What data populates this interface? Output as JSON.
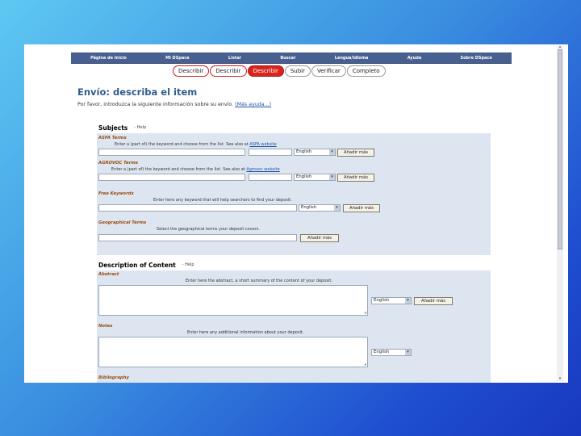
{
  "nav": {
    "items": [
      "Página de inicio",
      "Mi DSpace",
      "Listar",
      "Buscar",
      "Lengua/Idioma",
      "Ayuda",
      "Sobre DSpace"
    ]
  },
  "steps": [
    "Describir",
    "Describir",
    "Describir",
    "Subir",
    "Verificar",
    "Completo"
  ],
  "title": "Envío: describa el item",
  "intro": {
    "text": "Por favor, introduzca la siguiente información sobre su envío.",
    "link": "(Más ayuda...)"
  },
  "subjects": {
    "heading": "Subjects",
    "help": "- Help",
    "asfa": {
      "label": "ASFA Terms",
      "hint": "Enter a (part of) the keyword and choose from the list. See also at",
      "link": "ASFA website",
      "lang": "English",
      "add": "Añadir más"
    },
    "agrovoc": {
      "label": "AGROVOC Terms",
      "hint": "Enter a (part of) the keyword and choose from the list. See also at",
      "link": "Agrovoc website",
      "lang": "English",
      "add": "Añadir más"
    },
    "free": {
      "label": "Free Keywords",
      "hint": "Enter here any keyword that will help searchers to find your deposit.",
      "lang": "English",
      "add": "Añadir más"
    },
    "geo": {
      "label": "Geographical Terms",
      "hint": "Select the geographical terms your deposit covers.",
      "add": "Añadir más"
    }
  },
  "description": {
    "heading": "Description of Content",
    "help": "- Help",
    "abstract": {
      "label": "Abstract",
      "hint": "Enter here the abstract, a short summary of the content of your deposit.",
      "lang": "English",
      "add": "Añadir más"
    },
    "notes": {
      "label": "Notes",
      "hint": "Enter here any additional information about your deposit.",
      "lang": "English"
    },
    "bibliography": {
      "label": "Bibliography"
    }
  }
}
